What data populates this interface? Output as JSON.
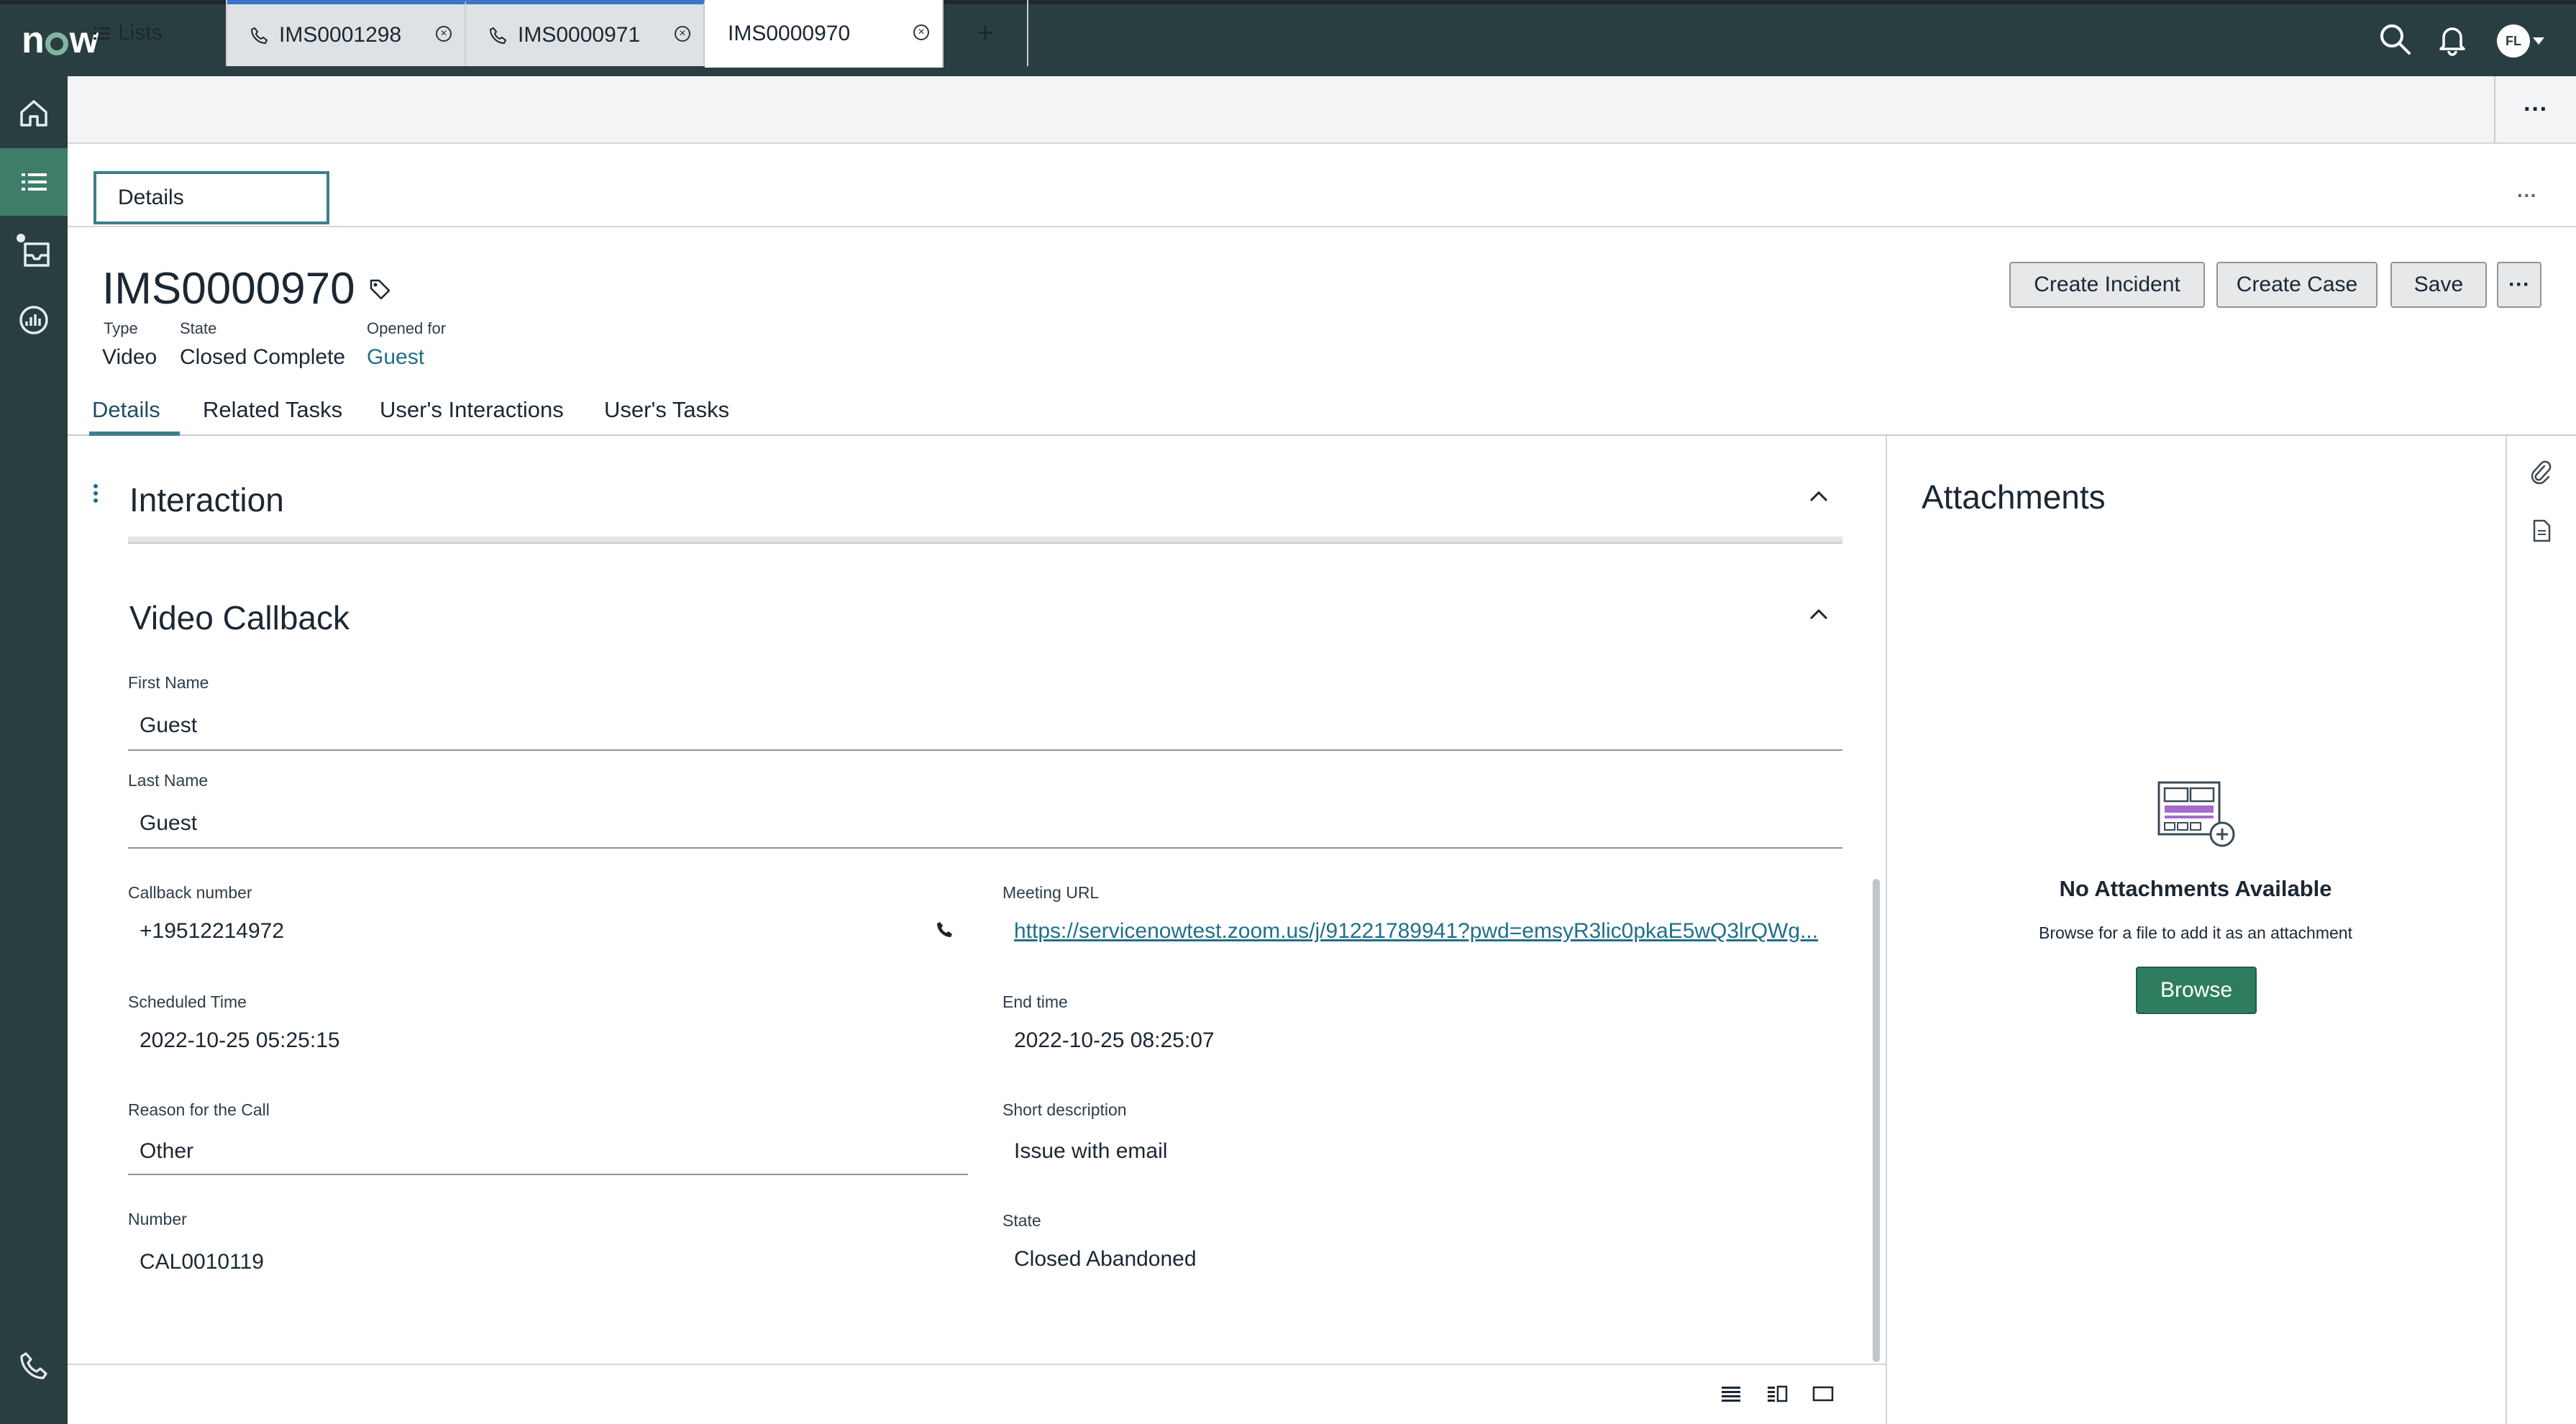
{
  "header": {
    "logo_text": "now",
    "avatar_initials": "FL",
    "icons": [
      "search-icon",
      "bell-icon",
      "user-avatar"
    ]
  },
  "rail": {
    "items": [
      "home-icon",
      "list-icon",
      "inbox-icon",
      "analytics-icon",
      "phone-icon"
    ],
    "active": "list-icon"
  },
  "tabs": {
    "lists_label": "Lists",
    "items": [
      {
        "label": "IMS0001298",
        "icon": "phone-icon"
      },
      {
        "label": "IMS0000971",
        "icon": "phone-icon"
      },
      {
        "label": "IMS0000970"
      }
    ],
    "add_label": "+",
    "more_label": "···"
  },
  "subheader": {
    "details_label": "Details",
    "more_label": "···"
  },
  "record": {
    "number": "IMS0000970",
    "type_label": "Type",
    "type_value": "Video",
    "state_label": "State",
    "state_value": "Closed Complete",
    "opened_for_label": "Opened for",
    "opened_for_value": "Guest",
    "buttons": {
      "create_incident": "Create Incident",
      "create_case": "Create Case",
      "save": "Save",
      "more": "···"
    }
  },
  "record_tabs": [
    "Details",
    "Related Tasks",
    "User's Interactions",
    "User's Tasks"
  ],
  "form": {
    "interaction_title": "Interaction",
    "video_callback_title": "Video Callback",
    "first_name_label": "First Name",
    "first_name_value": "Guest",
    "last_name_label": "Last Name",
    "last_name_value": "Guest",
    "callback_number_label": "Callback number",
    "callback_number_value": "+19512214972",
    "meeting_url_label": "Meeting URL",
    "meeting_url_value": "https://servicenowtest.zoom.us/j/91221789941?pwd=emsyR3lic0pkaE5wQ3lrQWg...",
    "scheduled_time_label": "Scheduled Time",
    "scheduled_time_value": "2022-10-25 05:25:15",
    "end_time_label": "End time",
    "end_time_value": "2022-10-25 08:25:07",
    "reason_label": "Reason for the Call",
    "reason_value": "Other",
    "short_desc_label": "Short description",
    "short_desc_value": "Issue with email",
    "number_label": "Number",
    "number_value": "CAL0010119",
    "state_label": "State",
    "state_value": "Closed Abandoned"
  },
  "attachments": {
    "title": "Attachments",
    "empty_title": "No Attachments Available",
    "empty_sub": "Browse for a file to add it as an attachment",
    "browse_label": "Browse"
  },
  "colors": {
    "header_bg": "#293e40",
    "rail_active": "#3f7d6b",
    "accent_teal": "#3f7d8e",
    "link": "#1f6f8b",
    "primary_button": "#2f7d5f"
  }
}
